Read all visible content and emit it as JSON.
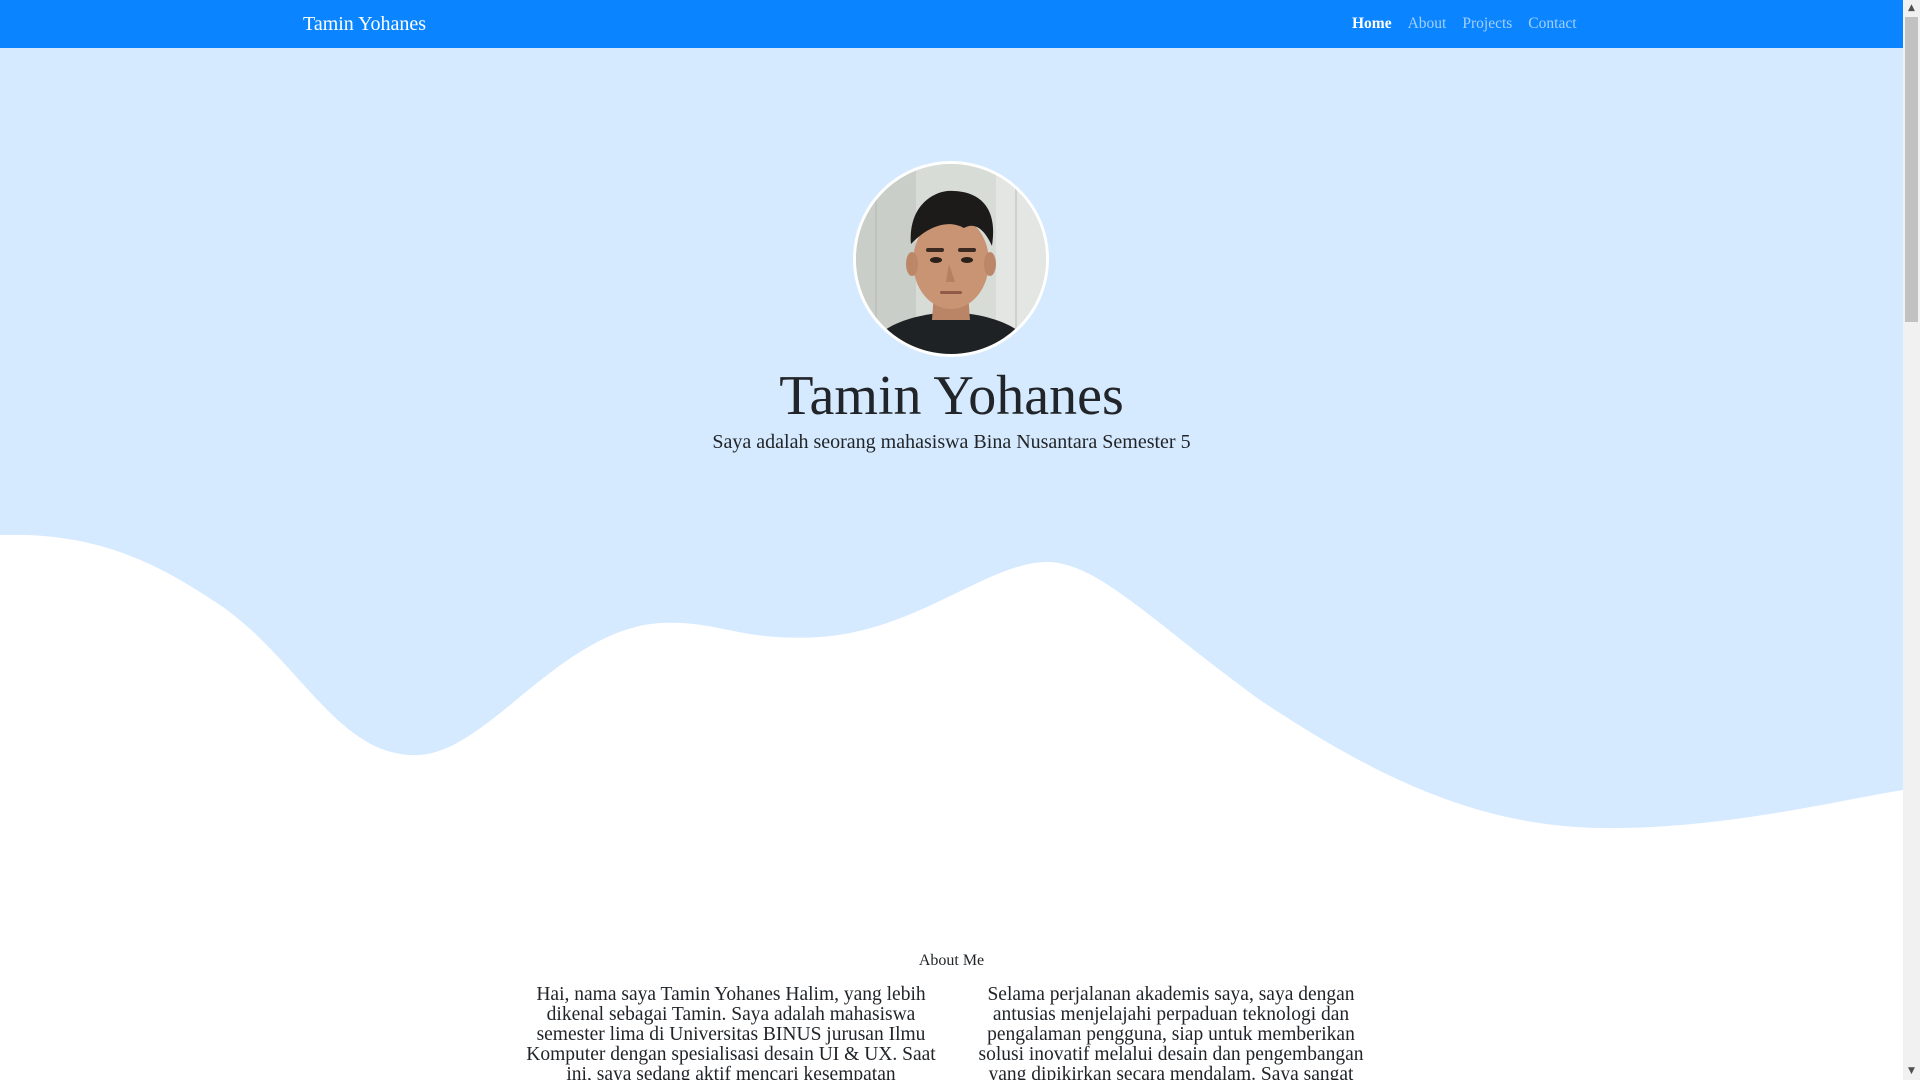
{
  "navbar": {
    "brand": "Tamin Yohanes",
    "links": [
      {
        "label": "Home",
        "active": true
      },
      {
        "label": "About",
        "active": false
      },
      {
        "label": "Projects",
        "active": false
      },
      {
        "label": "Contact",
        "active": false
      }
    ]
  },
  "hero": {
    "name": "Tamin Yohanes",
    "subtitle": "Saya adalah seorang mahasiswa Bina Nusantara Semester 5"
  },
  "about": {
    "title": "About Me",
    "paragraph_left": "Hai, nama saya Tamin Yohanes Halim, yang lebih dikenal sebagai Tamin. Saya adalah mahasiswa semester lima di Universitas BINUS jurusan Ilmu Komputer dengan spesialisasi desain UI & UX. Saat ini, saya sedang aktif mencari kesempatan",
    "paragraph_right": "Selama perjalanan akademis saya, saya dengan antusias menjelajahi perpaduan teknologi dan pengalaman pengguna, siap untuk memberikan solusi inovatif melalui desain dan pengembangan yang dipikirkan secara mendalam. Saya sangat"
  },
  "colors": {
    "navbar": "#0a84ff",
    "hero_background": "#d6eaff",
    "text": "#212529"
  }
}
